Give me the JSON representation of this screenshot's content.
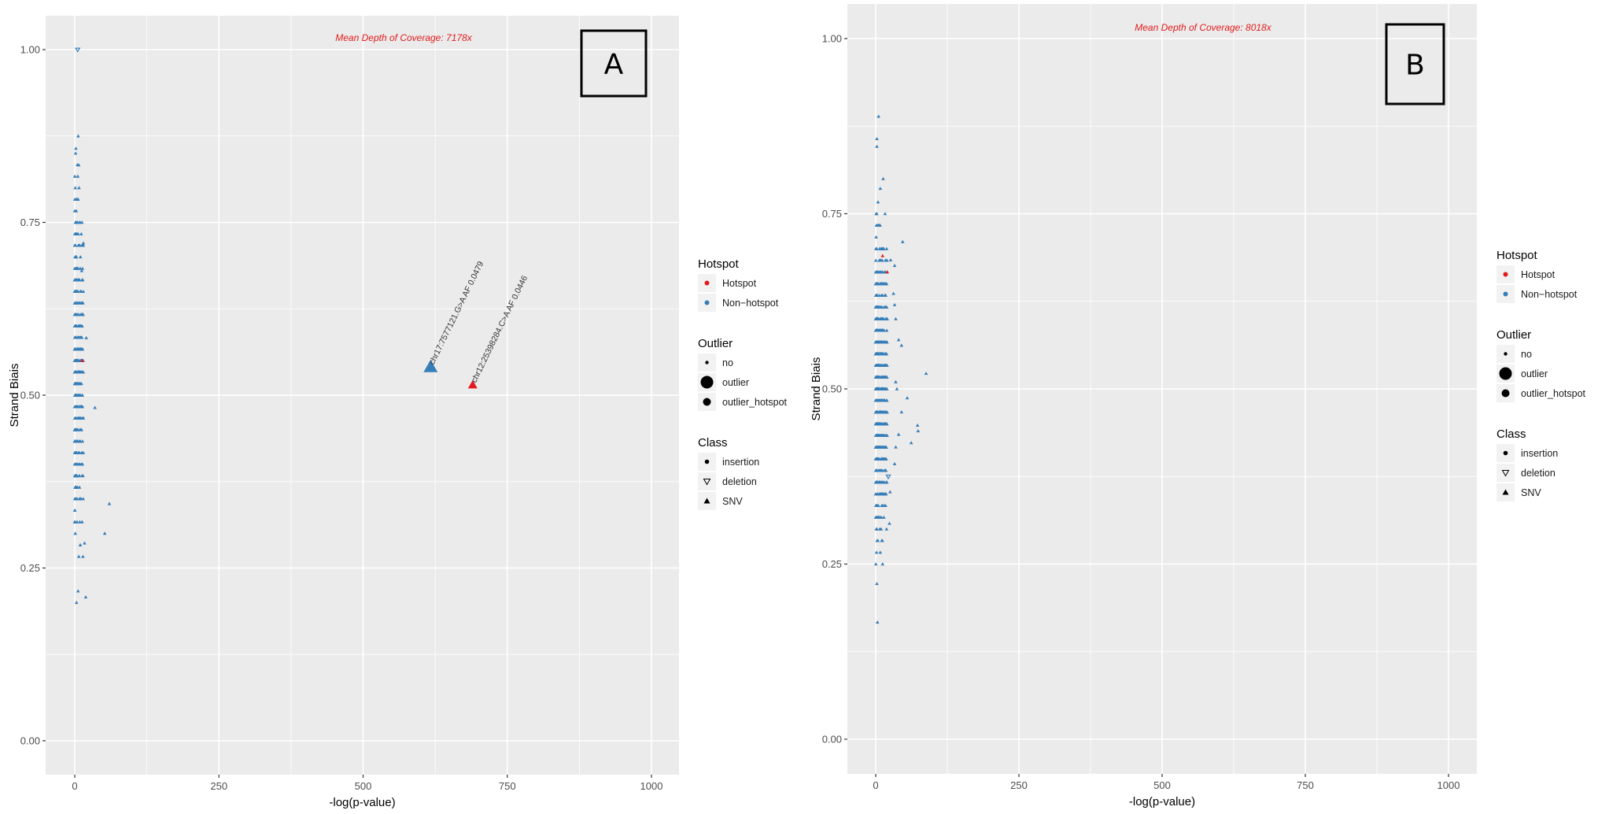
{
  "chart_data": [
    {
      "panel": "A",
      "type": "scatter",
      "title": "",
      "annotation": "Mean Depth of Coverage: 7178x",
      "xlabel": "-log(p-value)",
      "ylabel": "Strand Biais",
      "xlim": [
        -50,
        1050
      ],
      "ylim": [
        -0.05,
        1.05
      ],
      "xticks": [
        0,
        250,
        500,
        750,
        1000
      ],
      "xtick_labels": [
        "0",
        "250",
        "500",
        "750",
        "1000"
      ],
      "yticks": [
        0,
        0.25,
        0.5,
        0.75,
        1.0
      ],
      "ytick_labels": [
        "0.00",
        "0.25",
        "0.50",
        "0.75",
        "1.00"
      ],
      "grid": true,
      "cluster": {
        "x_range": [
          0,
          15
        ],
        "y_range": [
          0.2,
          0.875
        ],
        "class": "SNV",
        "hotspot": "Non-hotspot",
        "outlier": "no",
        "approx_count": 400
      },
      "points": [
        {
          "x": 5,
          "y": 1.0,
          "class": "deletion",
          "hotspot": "Non-hotspot",
          "outlier": "no"
        },
        {
          "x": 6,
          "y": 0.875,
          "class": "SNV",
          "hotspot": "Non-hotspot",
          "outlier": "no"
        },
        {
          "x": 2,
          "y": 0.857,
          "class": "SNV",
          "hotspot": "Non-hotspot",
          "outlier": "no"
        },
        {
          "x": 7,
          "y": 0.833,
          "class": "SNV",
          "hotspot": "Non-hotspot",
          "outlier": "no"
        },
        {
          "x": 1,
          "y": 0.8,
          "class": "SNV",
          "hotspot": "Non-hotspot",
          "outlier": "no"
        },
        {
          "x": 15,
          "y": 0.72,
          "class": "SNV",
          "hotspot": "Non-hotspot",
          "outlier": "no"
        },
        {
          "x": 12,
          "y": 0.68,
          "class": "SNV",
          "hotspot": "Non-hotspot",
          "outlier": "no"
        },
        {
          "x": 20,
          "y": 0.583,
          "class": "SNV",
          "hotspot": "Non-hotspot",
          "outlier": "no"
        },
        {
          "x": 13,
          "y": 0.55,
          "class": "SNV",
          "hotspot": "Hotspot",
          "outlier": "no"
        },
        {
          "x": 35,
          "y": 0.482,
          "class": "SNV",
          "hotspot": "Non-hotspot",
          "outlier": "no"
        },
        {
          "x": 15,
          "y": 0.467,
          "class": "SNV",
          "hotspot": "Non-hotspot",
          "outlier": "no"
        },
        {
          "x": 60,
          "y": 0.343,
          "class": "SNV",
          "hotspot": "Non-hotspot",
          "outlier": "no"
        },
        {
          "x": 52,
          "y": 0.3,
          "class": "SNV",
          "hotspot": "Non-hotspot",
          "outlier": "no"
        },
        {
          "x": 17,
          "y": 0.286,
          "class": "SNV",
          "hotspot": "Non-hotspot",
          "outlier": "no"
        },
        {
          "x": 19,
          "y": 0.208,
          "class": "SNV",
          "hotspot": "Non-hotspot",
          "outlier": "no"
        },
        {
          "x": 3,
          "y": 0.2,
          "class": "SNV",
          "hotspot": "Non-hotspot",
          "outlier": "no"
        },
        {
          "x": 617,
          "y": 0.541,
          "class": "SNV",
          "hotspot": "Non-hotspot",
          "outlier": "outlier",
          "label": "chr17:7577121.G>A AF 0.0479"
        },
        {
          "x": 690,
          "y": 0.515,
          "class": "SNV",
          "hotspot": "Hotspot",
          "outlier": "outlier_hotspot",
          "label": "chr12:25398284.C>A AF 0.0446"
        }
      ]
    },
    {
      "panel": "B",
      "type": "scatter",
      "title": "",
      "annotation": "Mean Depth of Coverage: 8018x",
      "xlabel": "-log(p-value)",
      "ylabel": "Strand Biais",
      "xlim": [
        -50,
        1050
      ],
      "ylim": [
        -0.05,
        1.05
      ],
      "xticks": [
        0,
        250,
        500,
        750,
        1000
      ],
      "xtick_labels": [
        "0",
        "250",
        "500",
        "750",
        "1000"
      ],
      "yticks": [
        0,
        0.25,
        0.5,
        0.75,
        1.0
      ],
      "ytick_labels": [
        "0.00",
        "0.25",
        "0.50",
        "0.75",
        "1.00"
      ],
      "grid": true,
      "cluster": {
        "x_range": [
          0,
          20
        ],
        "y_range": [
          0.22,
          0.8
        ],
        "class": "SNV",
        "hotspot": "Non-hotspot",
        "outlier": "no",
        "approx_count": 800
      },
      "points": [
        {
          "x": 5,
          "y": 0.889,
          "class": "SNV",
          "hotspot": "Non-hotspot",
          "outlier": "no"
        },
        {
          "x": 2,
          "y": 0.857,
          "class": "SNV",
          "hotspot": "Non-hotspot",
          "outlier": "no"
        },
        {
          "x": 2,
          "y": 0.846,
          "class": "SNV",
          "hotspot": "Non-hotspot",
          "outlier": "no"
        },
        {
          "x": 13,
          "y": 0.8,
          "class": "SNV",
          "hotspot": "Non-hotspot",
          "outlier": "no"
        },
        {
          "x": 8,
          "y": 0.786,
          "class": "SNV",
          "hotspot": "Non-hotspot",
          "outlier": "no"
        },
        {
          "x": 47,
          "y": 0.71,
          "class": "SNV",
          "hotspot": "Non-hotspot",
          "outlier": "no"
        },
        {
          "x": 12,
          "y": 0.69,
          "class": "SNV",
          "hotspot": "Hotspot",
          "outlier": "no"
        },
        {
          "x": 20,
          "y": 0.667,
          "class": "SNV",
          "hotspot": "Hotspot",
          "outlier": "no"
        },
        {
          "x": 26,
          "y": 0.684,
          "class": "SNV",
          "hotspot": "Non-hotspot",
          "outlier": "no"
        },
        {
          "x": 33,
          "y": 0.676,
          "class": "SNV",
          "hotspot": "Non-hotspot",
          "outlier": "no"
        },
        {
          "x": 31,
          "y": 0.636,
          "class": "SNV",
          "hotspot": "Non-hotspot",
          "outlier": "no"
        },
        {
          "x": 33,
          "y": 0.62,
          "class": "SNV",
          "hotspot": "Non-hotspot",
          "outlier": "no"
        },
        {
          "x": 35,
          "y": 0.6,
          "class": "SNV",
          "hotspot": "Non-hotspot",
          "outlier": "no"
        },
        {
          "x": 40,
          "y": 0.57,
          "class": "SNV",
          "hotspot": "Non-hotspot",
          "outlier": "no"
        },
        {
          "x": 45,
          "y": 0.562,
          "class": "SNV",
          "hotspot": "Non-hotspot",
          "outlier": "no"
        },
        {
          "x": 88,
          "y": 0.522,
          "class": "SNV",
          "hotspot": "Non-hotspot",
          "outlier": "no"
        },
        {
          "x": 35,
          "y": 0.51,
          "class": "SNV",
          "hotspot": "Non-hotspot",
          "outlier": "no"
        },
        {
          "x": 37,
          "y": 0.5,
          "class": "SNV",
          "hotspot": "Non-hotspot",
          "outlier": "no"
        },
        {
          "x": 55,
          "y": 0.487,
          "class": "SNV",
          "hotspot": "Non-hotspot",
          "outlier": "no"
        },
        {
          "x": 45,
          "y": 0.467,
          "class": "SNV",
          "hotspot": "Non-hotspot",
          "outlier": "no"
        },
        {
          "x": 73,
          "y": 0.448,
          "class": "SNV",
          "hotspot": "Non-hotspot",
          "outlier": "no"
        },
        {
          "x": 74,
          "y": 0.44,
          "class": "SNV",
          "hotspot": "Non-hotspot",
          "outlier": "no"
        },
        {
          "x": 40,
          "y": 0.435,
          "class": "SNV",
          "hotspot": "Non-hotspot",
          "outlier": "no"
        },
        {
          "x": 62,
          "y": 0.423,
          "class": "SNV",
          "hotspot": "Non-hotspot",
          "outlier": "no"
        },
        {
          "x": 35,
          "y": 0.417,
          "class": "SNV",
          "hotspot": "Non-hotspot",
          "outlier": "no"
        },
        {
          "x": 33,
          "y": 0.393,
          "class": "SNV",
          "hotspot": "Non-hotspot",
          "outlier": "no"
        },
        {
          "x": 22,
          "y": 0.375,
          "class": "deletion",
          "hotspot": "Non-hotspot",
          "outlier": "no"
        },
        {
          "x": 25,
          "y": 0.353,
          "class": "SNV",
          "hotspot": "Non-hotspot",
          "outlier": "no"
        },
        {
          "x": 24,
          "y": 0.308,
          "class": "SNV",
          "hotspot": "Non-hotspot",
          "outlier": "no"
        },
        {
          "x": 12,
          "y": 0.25,
          "class": "SNV",
          "hotspot": "Non-hotspot",
          "outlier": "no"
        },
        {
          "x": 2,
          "y": 0.222,
          "class": "SNV",
          "hotspot": "Non-hotspot",
          "outlier": "no"
        },
        {
          "x": 3,
          "y": 0.167,
          "class": "SNV",
          "hotspot": "Non-hotspot",
          "outlier": "no"
        }
      ]
    }
  ],
  "panels": {
    "A": {
      "letter": "A",
      "depth": "Mean Depth of Coverage: 7178x"
    },
    "B": {
      "letter": "B",
      "depth": "Mean Depth of Coverage: 8018x"
    }
  },
  "axes": {
    "xlabel": "-log(p-value)",
    "ylabel": "Strand Biais",
    "xticks": [
      "0",
      "250",
      "500",
      "750",
      "1000"
    ],
    "yticks": [
      "0.00",
      "0.25",
      "0.50",
      "0.75",
      "1.00"
    ]
  },
  "legend": {
    "hotspot": {
      "title": "Hotspot",
      "items": [
        {
          "label": "Hotspot",
          "color": "#e41a1c"
        },
        {
          "label": "Non−hotspot",
          "color": "#377eb8"
        }
      ]
    },
    "outlier": {
      "title": "Outlier",
      "items": [
        {
          "label": "no",
          "size": "small"
        },
        {
          "label": "outlier",
          "size": "large"
        },
        {
          "label": "outlier_hotspot",
          "size": "medium"
        }
      ]
    },
    "class": {
      "title": "Class",
      "items": [
        {
          "label": "insertion",
          "shape": "circle-icon"
        },
        {
          "label": "deletion",
          "shape": "triangle-down-open-icon"
        },
        {
          "label": "SNV",
          "shape": "triangle-up-icon"
        }
      ]
    }
  },
  "colors": {
    "panel_bg": "#ebebeb",
    "grid": "#ffffff",
    "hotspot": "#e41a1c",
    "non_hotspot": "#377eb8",
    "annotation": "#e41a1c"
  }
}
